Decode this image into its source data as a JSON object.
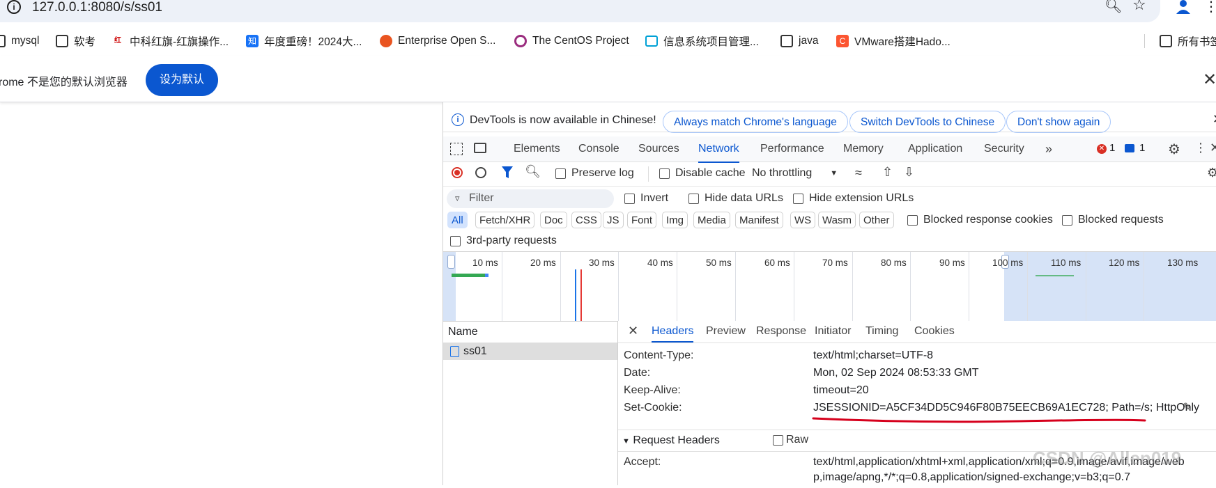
{
  "browser": {
    "url": "127.0.0.1:8080/s/ss01",
    "bookmarks": [
      {
        "label": "mysql",
        "icon": "folder-icon"
      },
      {
        "label": "软考",
        "icon": "folder-icon"
      },
      {
        "label": "中科红旗-红旗操作...",
        "icon": "hongqi-icon"
      },
      {
        "label": "年度重磅！2024大...",
        "icon": "zhihu-icon"
      },
      {
        "label": "Enterprise Open S...",
        "icon": "ubuntu-icon"
      },
      {
        "label": "The CentOS Project",
        "icon": "centos-icon"
      },
      {
        "label": "信息系统项目管理...",
        "icon": "bilibili-icon"
      },
      {
        "label": "java",
        "icon": "folder-icon"
      },
      {
        "label": "VMware搭建Hado...",
        "icon": "csdn-icon"
      },
      {
        "label": "所有书签",
        "icon": "folder-icon"
      }
    ],
    "infobar": {
      "text": "rome 不是您的默认浏览器",
      "button": "设为默认"
    }
  },
  "devtools": {
    "banner": {
      "text": "DevTools is now available in Chinese!",
      "btn_match": "Always match Chrome's language",
      "btn_switch": "Switch DevTools to Chinese",
      "btn_dont": "Don't show again"
    },
    "tabs": [
      "Elements",
      "Console",
      "Sources",
      "Network",
      "Performance",
      "Memory",
      "Application",
      "Security"
    ],
    "active_tab": "Network",
    "errors": "1",
    "messages": "1",
    "toolbar": {
      "preserve_log": "Preserve log",
      "disable_cache": "Disable cache",
      "throttling": "No throttling"
    },
    "filter": {
      "placeholder": "Filter",
      "invert": "Invert",
      "hide_data": "Hide data URLs",
      "hide_ext": "Hide extension URLs"
    },
    "types": [
      "All",
      "Fetch/XHR",
      "Doc",
      "CSS",
      "JS",
      "Font",
      "Img",
      "Media",
      "Manifest",
      "WS",
      "Wasm",
      "Other"
    ],
    "blocked_cookies": "Blocked response cookies",
    "blocked_requests": "Blocked requests",
    "third_party": "3rd-party requests",
    "timeline_ticks": [
      "10 ms",
      "20 ms",
      "30 ms",
      "40 ms",
      "50 ms",
      "60 ms",
      "70 ms",
      "80 ms",
      "90 ms",
      "100 ms",
      "110 ms",
      "120 ms",
      "130 ms"
    ],
    "name_header": "Name",
    "request": "ss01",
    "detail_tabs": [
      "Headers",
      "Preview",
      "Response",
      "Initiator",
      "Timing",
      "Cookies"
    ],
    "headers": [
      {
        "k": "Content-Type:",
        "v": "text/html;charset=UTF-8"
      },
      {
        "k": "Date:",
        "v": "Mon, 02 Sep 2024 08:53:33 GMT"
      },
      {
        "k": "Keep-Alive:",
        "v": "timeout=20"
      },
      {
        "k": "Set-Cookie:",
        "v": "JSESSIONID=A5CF34DD5C946F80B75EECB69A1EC728; Path=/s; HttpOnly"
      }
    ],
    "request_headers_title": "Request Headers",
    "raw": "Raw",
    "accept_key": "Accept:",
    "accept_val": "text/html,application/xhtml+xml,application/xml;q=0.9,image/avif,image/web",
    "accept_val2": "p,image/apng,*/*;q=0.8,application/signed-exchange;v=b3;q=0.7",
    "watermark": "CSDN @Allen019",
    "accent": "#0b57d0",
    "underline_color": "#d6001c"
  }
}
